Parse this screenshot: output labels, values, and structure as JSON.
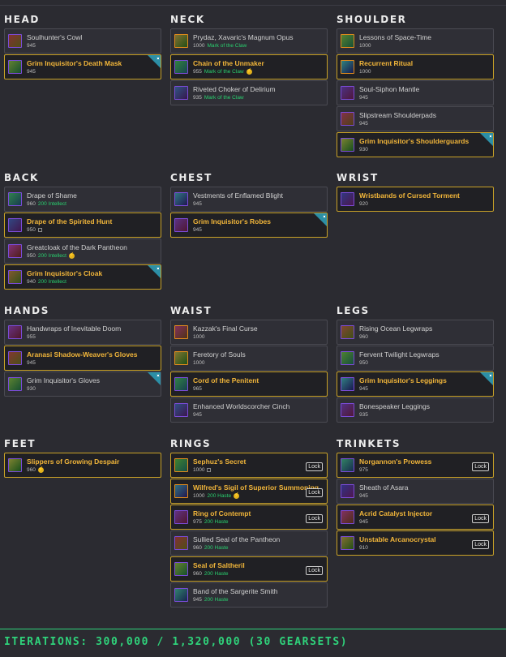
{
  "footer": {
    "iterations": "ITERATIONS: 300,000 / 1,320,000 (30 GEARSETS)"
  },
  "sections": [
    {
      "title": "HEAD",
      "items": [
        {
          "name": "Soulhunter's Cowl",
          "ilvl": "945",
          "selected": false
        },
        {
          "name": "Grim Inquisitor's Death Mask",
          "ilvl": "945",
          "selected": true,
          "corner": true
        }
      ]
    },
    {
      "title": "NECK",
      "items": [
        {
          "name": "Prydaz, Xavaric's Magnum Opus",
          "ilvl": "1000",
          "tag": "Mark of the Claw",
          "selected": false,
          "legendary": true
        },
        {
          "name": "Chain of the Unmaker",
          "ilvl": "955",
          "tag": "Mark of the Claw",
          "badge": true,
          "selected": true
        },
        {
          "name": "Riveted Choker of Delirium",
          "ilvl": "935",
          "tag": "Mark of the Claw",
          "selected": false
        }
      ]
    },
    {
      "title": "SHOULDER",
      "items": [
        {
          "name": "Lessons of Space-Time",
          "ilvl": "1000",
          "selected": false,
          "legendary": true
        },
        {
          "name": "Recurrent Ritual",
          "ilvl": "1000",
          "selected": true,
          "legendary": true
        },
        {
          "name": "Soul-Siphon Mantle",
          "ilvl": "945",
          "selected": false
        },
        {
          "name": "Slipstream Shoulderpads",
          "ilvl": "945",
          "selected": false
        },
        {
          "name": "Grim Inquisitor's Shoulderguards",
          "ilvl": "930",
          "selected": true,
          "corner": true
        }
      ]
    },
    {
      "title": "BACK",
      "items": [
        {
          "name": "Drape of Shame",
          "ilvl": "960",
          "stat": "200 Intellect",
          "selected": false
        },
        {
          "name": "Drape of the Spirited Hunt",
          "ilvl": "950",
          "socket": true,
          "selected": true
        },
        {
          "name": "Greatcloak of the Dark Pantheon",
          "ilvl": "950",
          "stat": "200 Intellect",
          "badge": true,
          "selected": false
        },
        {
          "name": "Grim Inquisitor's Cloak",
          "ilvl": "940",
          "stat": "200 Intellect",
          "selected": true,
          "corner": true
        }
      ]
    },
    {
      "title": "CHEST",
      "items": [
        {
          "name": "Vestments of Enflamed Blight",
          "ilvl": "945",
          "selected": false
        },
        {
          "name": "Grim Inquisitor's Robes",
          "ilvl": "945",
          "selected": true,
          "corner": true
        }
      ]
    },
    {
      "title": "WRIST",
      "items": [
        {
          "name": "Wristbands of Cursed Torment",
          "ilvl": "920",
          "selected": true
        }
      ]
    },
    {
      "title": "HANDS",
      "items": [
        {
          "name": "Handwraps of Inevitable Doom",
          "ilvl": "955",
          "selected": false
        },
        {
          "name": "Aranasi Shadow-Weaver's Gloves",
          "ilvl": "945",
          "selected": true
        },
        {
          "name": "Grim Inquisitor's Gloves",
          "ilvl": "930",
          "selected": false,
          "corner": true
        }
      ]
    },
    {
      "title": "WAIST",
      "items": [
        {
          "name": "Kazzak's Final Curse",
          "ilvl": "1000",
          "selected": false,
          "legendary": true
        },
        {
          "name": "Feretory of Souls",
          "ilvl": "1000",
          "selected": false,
          "legendary": true
        },
        {
          "name": "Cord of the Penitent",
          "ilvl": "965",
          "selected": true
        },
        {
          "name": "Enhanced Worldscorcher Cinch",
          "ilvl": "945",
          "selected": false
        }
      ]
    },
    {
      "title": "LEGS",
      "items": [
        {
          "name": "Rising Ocean Legwraps",
          "ilvl": "960",
          "selected": false
        },
        {
          "name": "Fervent Twilight Legwraps",
          "ilvl": "950",
          "selected": false
        },
        {
          "name": "Grim Inquisitor's Leggings",
          "ilvl": "945",
          "selected": true,
          "corner": true
        },
        {
          "name": "Bonespeaker Leggings",
          "ilvl": "935",
          "selected": false
        }
      ]
    },
    {
      "title": "FEET",
      "items": [
        {
          "name": "Slippers of Growing Despair",
          "ilvl": "960",
          "badge": true,
          "selected": true
        }
      ]
    },
    {
      "title": "RINGS",
      "items": [
        {
          "name": "Sephuz's Secret",
          "ilvl": "1000",
          "socket": true,
          "selected": true,
          "lock": "Lock",
          "legendary": true
        },
        {
          "name": "Wilfred's Sigil of Superior Summoning",
          "ilvl": "1000",
          "stat": "200 Haste",
          "badge": true,
          "selected": true,
          "lock": "Lock",
          "legendary": true
        },
        {
          "name": "Ring of Contempt",
          "ilvl": "975",
          "stat": "200 Haste",
          "selected": true,
          "lock": "Lock"
        },
        {
          "name": "Sullied Seal of the Pantheon",
          "ilvl": "960",
          "stat": "200 Haste",
          "selected": false
        },
        {
          "name": "Seal of Saltheril",
          "ilvl": "960",
          "stat": "200 Haste",
          "selected": true,
          "lock": "Lock"
        },
        {
          "name": "Band of the Sargerite Smith",
          "ilvl": "945",
          "stat": "200 Haste",
          "selected": false
        }
      ]
    },
    {
      "title": "TRINKETS",
      "items": [
        {
          "name": "Norgannon's Prowess",
          "ilvl": "975",
          "selected": true,
          "lock": "Lock"
        },
        {
          "name": "Sheath of Asara",
          "ilvl": "945",
          "selected": false
        },
        {
          "name": "Acrid Catalyst Injector",
          "ilvl": "945",
          "selected": true,
          "lock": "Lock"
        },
        {
          "name": "Unstable Arcanocrystal",
          "ilvl": "910",
          "selected": true,
          "lock": "Lock"
        }
      ]
    }
  ],
  "colors": {
    "background": "#2b2b31",
    "selected_border": "#c9a227",
    "selected_name": "#f2b63a",
    "stat_green": "#29d16f",
    "epic_border": "#7a4bd6",
    "legendary_border": "#e08a1c",
    "tier_corner": "#2c8fa6"
  },
  "icons": {
    "item": "item-icon",
    "set_bonus_corner": "tier-corner-icon",
    "badge": "leech-badge-icon",
    "socket": "gem-socket-icon"
  }
}
